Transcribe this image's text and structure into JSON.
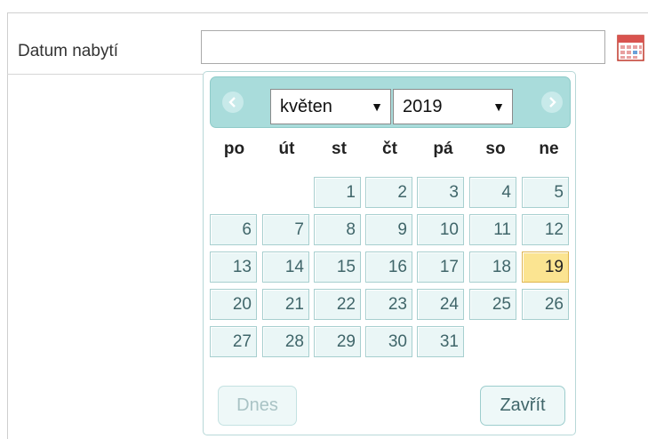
{
  "form": {
    "label": "Datum nabytí",
    "date_input_value": "",
    "calendar_icon": "calendar-icon"
  },
  "datepicker": {
    "prev_icon": "chevron-left-icon",
    "next_icon": "chevron-right-icon",
    "month": "květen",
    "year": "2019",
    "dropdown_icon": "triangle-down-icon",
    "weekdays": [
      "po",
      "út",
      "st",
      "čt",
      "pá",
      "so",
      "ne"
    ],
    "days": [
      "1",
      "2",
      "3",
      "4",
      "5",
      "6",
      "7",
      "8",
      "9",
      "10",
      "11",
      "12",
      "13",
      "14",
      "15",
      "16",
      "17",
      "18",
      "19",
      "20",
      "21",
      "22",
      "23",
      "24",
      "25",
      "26",
      "27",
      "28",
      "29",
      "30",
      "31"
    ],
    "first_weekday_index": 2,
    "today": "19",
    "today_button": "Dnes",
    "close_button": "Zavřít",
    "colors": {
      "header_bg": "#a9dcdb",
      "day_bg": "#eaf6f6",
      "day_text": "#40666a",
      "today_bg": "#fbe491",
      "today_border": "#e0b54d"
    }
  }
}
